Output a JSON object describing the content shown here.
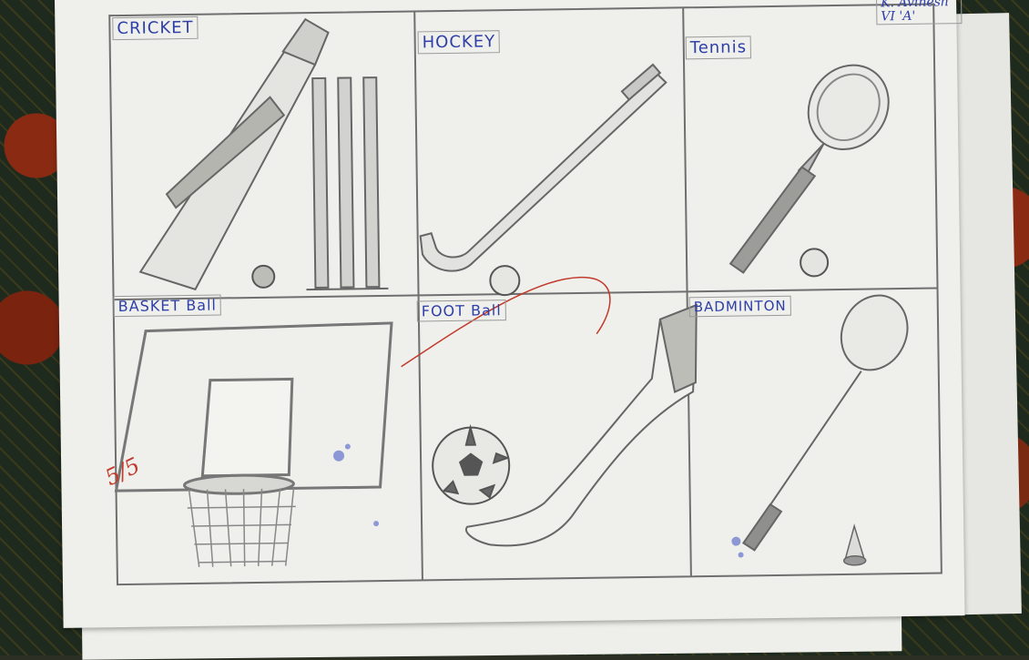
{
  "drawing": {
    "panels": [
      {
        "label": "CRICKET",
        "subject": "cricket bat, stumps and ball"
      },
      {
        "label": "HOCKEY",
        "subject": "hockey stick and ball"
      },
      {
        "label": "Tennis",
        "subject": "tennis racket and ball"
      },
      {
        "label": "BASKET Ball",
        "subject": "basketball backboard, hoop and net"
      },
      {
        "label": "FOOT Ball",
        "subject": "leg kicking a football"
      },
      {
        "label": "BADMINTON",
        "subject": "badminton racket and shuttlecock"
      }
    ],
    "author": {
      "name": "K. Avinesh",
      "class": "VI 'A'"
    },
    "grade_mark": "5/5"
  },
  "colors": {
    "paper": "#efefec",
    "pencil": "#6f6f6f",
    "label_ink": "#2e3fa8",
    "red_ink": "#c23a2a",
    "cloth": "#2b2f24"
  }
}
